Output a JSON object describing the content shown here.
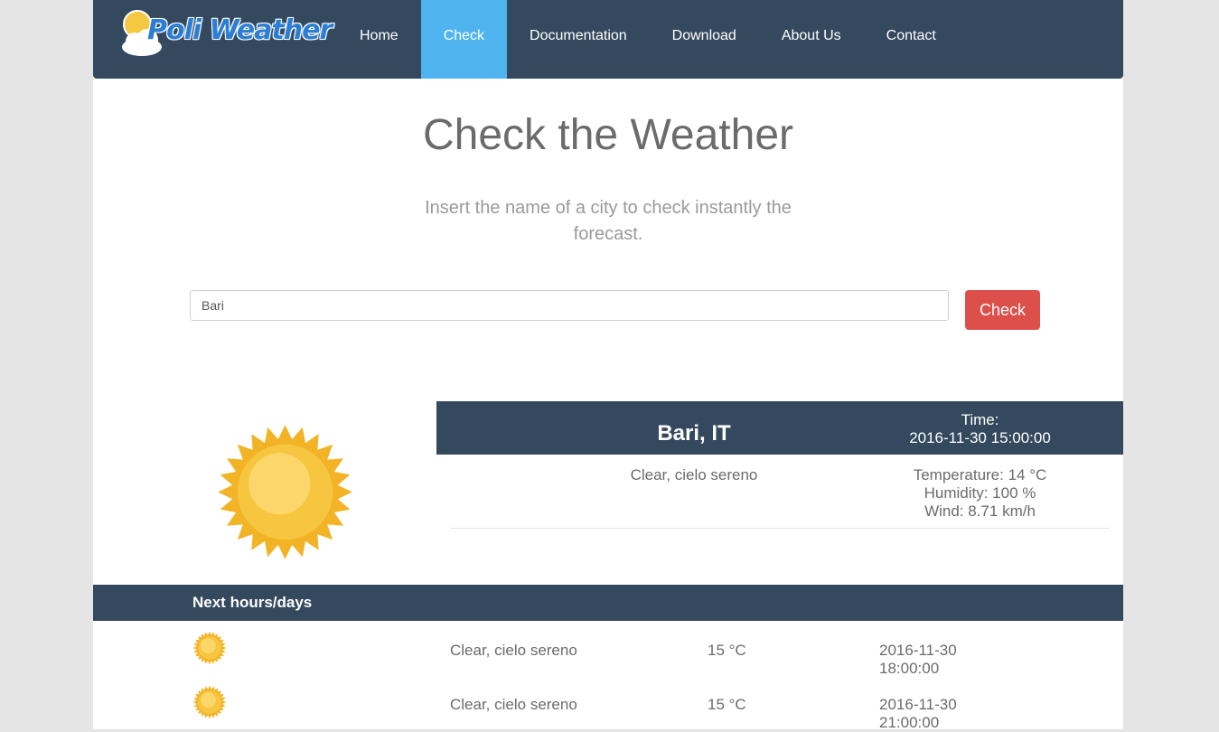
{
  "brand": {
    "name": "Poli Weather"
  },
  "nav": {
    "items": [
      {
        "label": "Home",
        "active": false
      },
      {
        "label": "Check",
        "active": true
      },
      {
        "label": "Documentation",
        "active": false
      },
      {
        "label": "Download",
        "active": false
      },
      {
        "label": "About Us",
        "active": false
      },
      {
        "label": "Contact",
        "active": false
      }
    ]
  },
  "hero": {
    "title": "Check the Weather",
    "subtitle": "Insert the name of a city to check instantly the forecast."
  },
  "search": {
    "value": "Bari",
    "button_label": "Check"
  },
  "current": {
    "icon": "sun-icon",
    "city": "Bari, IT",
    "time_label": "Time:",
    "time_value": "2016-11-30 15:00:00",
    "description": "Clear, cielo sereno",
    "temperature": "Temperature: 14 °C",
    "humidity": "Humidity: 100 %",
    "wind": "Wind: 8.71 km/h"
  },
  "forecast": {
    "title": "Next hours/days",
    "rows": [
      {
        "icon": "sun-icon",
        "description": "Clear, cielo sereno",
        "temp": "15 °C",
        "date": "2016-11-30",
        "time": "18:00:00"
      },
      {
        "icon": "sun-icon",
        "description": "Clear, cielo sereno",
        "temp": "15 °C",
        "date": "2016-11-30",
        "time": "21:00:00"
      }
    ]
  },
  "colors": {
    "navbar": "#34495e",
    "nav_active": "#4fb4ee",
    "check_button": "#dd4f4b",
    "sun": "#f5b82e"
  }
}
